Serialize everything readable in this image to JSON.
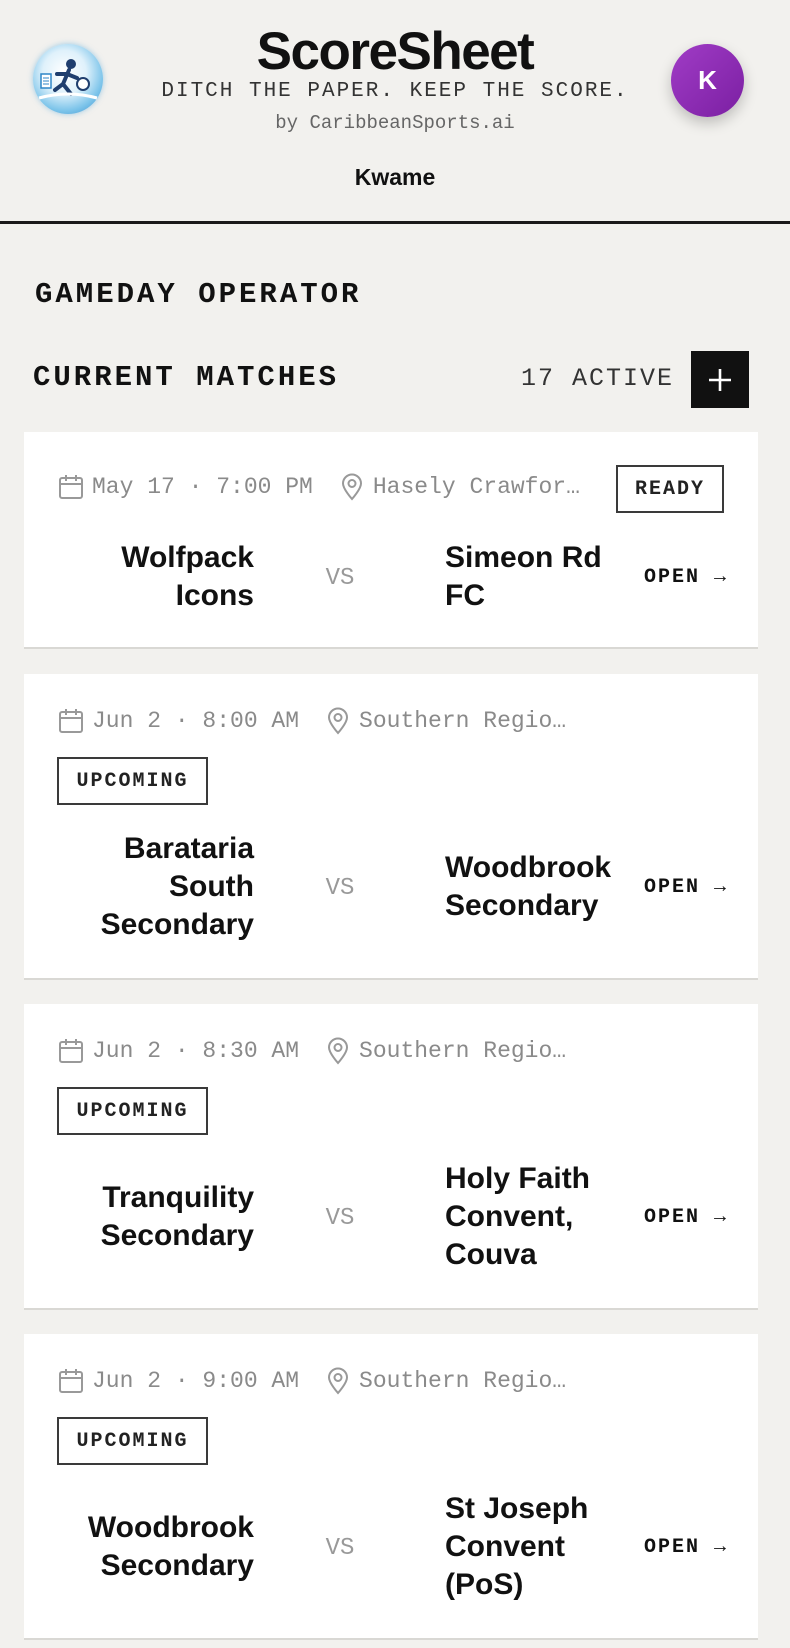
{
  "header": {
    "title": "ScoreSheet",
    "tagline": "DITCH THE PAPER. KEEP THE SCORE.",
    "byline": "by CaribbeanSports.ai",
    "username": "Kwame",
    "avatar_initial": "K",
    "avatar_color": "#8e2bb8"
  },
  "page": {
    "section_title": "GAMEDAY OPERATOR",
    "matches_title": "CURRENT MATCHES",
    "active_count": "17 ACTIVE",
    "add_icon": "plus-icon"
  },
  "matches": [
    {
      "date_time": "May 17 · 7:00 PM",
      "venue": "Hasely Crawfor…",
      "status": "READY",
      "home_team": "Wolfpack Icons",
      "away_team": "Simeon Rd FC",
      "vs_label": "VS",
      "open_label": "OPEN →"
    },
    {
      "date_time": "Jun 2 · 8:00 AM",
      "venue": "Southern Regio…",
      "status": "UPCOMING",
      "home_team": "Barataria South Secondary",
      "away_team": "Woodbrook Secondary",
      "vs_label": "VS",
      "open_label": "OPEN →"
    },
    {
      "date_time": "Jun 2 · 8:30 AM",
      "venue": "Southern Regio…",
      "status": "UPCOMING",
      "home_team": "Tranquility Secondary",
      "away_team": "Holy Faith Convent, Couva",
      "vs_label": "VS",
      "open_label": "OPEN →"
    },
    {
      "date_time": "Jun 2 · 9:00 AM",
      "venue": "Southern Regio…",
      "status": "UPCOMING",
      "home_team": "Woodbrook Secondary",
      "away_team": "St Joseph Convent (PoS)",
      "vs_label": "VS",
      "open_label": "OPEN →"
    }
  ]
}
